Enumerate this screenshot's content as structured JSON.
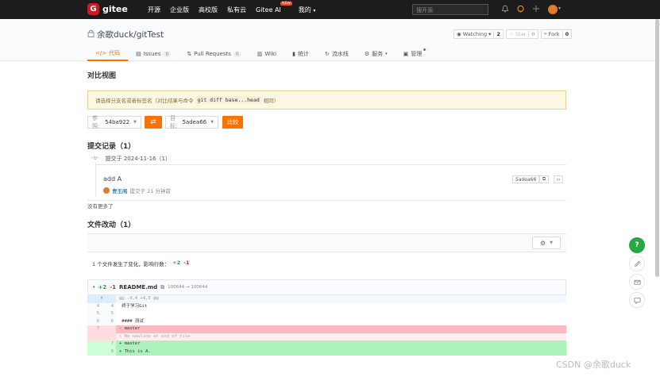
{
  "nav": {
    "logo_letter": "G",
    "logo_text": "gitee",
    "links": [
      "开源",
      "企业版",
      "高校版",
      "私有云",
      "Gitee AI",
      "我的"
    ],
    "new_badge": "NEW",
    "search_placeholder": "搜开源",
    "my_caret": "▾"
  },
  "repo": {
    "title": "余歌duck/gitTest",
    "watch_label": "Watching",
    "watch_count": "2",
    "star_label": "Star",
    "star_count": "0",
    "fork_label": "Fork",
    "fork_count": "0"
  },
  "tabs": [
    {
      "label": "代码",
      "icon": "</>",
      "count": ""
    },
    {
      "label": "Issues",
      "icon": "▤",
      "count": "0"
    },
    {
      "label": "Pull Requests",
      "icon": "⇅",
      "count": "0"
    },
    {
      "label": "Wiki",
      "icon": "▥",
      "count": ""
    },
    {
      "label": "统计",
      "icon": "▮",
      "count": ""
    },
    {
      "label": "流水线",
      "icon": "↻",
      "count": ""
    },
    {
      "label": "服务",
      "icon": "⚙",
      "count": "",
      "caret": "▾"
    },
    {
      "label": "管理",
      "icon": "▣",
      "count": ""
    }
  ],
  "compare": {
    "heading": "对比视图",
    "warning_prefix": "请选择分支名或者标签名（对比结果与命令",
    "warning_code": "git diff base...head",
    "warning_suffix": "相同）",
    "base_key": "参照:",
    "base_value": "54ba922",
    "target_key": "目标:",
    "target_value": "5adea66",
    "swap_icon": "⇄",
    "compare_btn": "比较"
  },
  "commits": {
    "heading": "提交记录（1）",
    "date_icon": "-o-",
    "date": "提交于 2024-11-16（1）",
    "message": "add A",
    "author": "曹玉阁",
    "time": "提交于 21 分钟前",
    "sha": "5adea66",
    "copy_icon": "⧉",
    "browse_icon": "‹›",
    "no_more": "没有更多了"
  },
  "files": {
    "heading": "文件改动（1）",
    "settings_icon": "⚙",
    "summary_text": "1 个文件发生了变化，影响行数：",
    "added": "+2",
    "removed": "-1",
    "file_caret": "▾",
    "file_added": "+2",
    "file_removed": "-1",
    "file_name": "README.md",
    "file_mode": "100644 → 100644"
  },
  "diff": [
    {
      "type": "hunk",
      "old": "",
      "new": "",
      "code": "@@ -4,4 +4,5 @@"
    },
    {
      "type": "ctx",
      "old": "4",
      "new": "4",
      "code": " 终于学习Git"
    },
    {
      "type": "ctx",
      "old": "5",
      "new": "5",
      "code": " "
    },
    {
      "type": "ctx",
      "old": "6",
      "new": "6",
      "code": " #### 测试"
    },
    {
      "type": "del",
      "old": "7",
      "new": "",
      "code": "- master"
    },
    {
      "type": "neutral",
      "old": "",
      "new": "",
      "code": "\\ No newline at end of file"
    },
    {
      "type": "add",
      "old": "",
      "new": "7",
      "code": "+ master"
    },
    {
      "type": "add",
      "old": "",
      "new": "8",
      "code": "+ This is A."
    }
  ],
  "side": {
    "help": "?",
    "watermark": "CSDN @余歌duck"
  }
}
